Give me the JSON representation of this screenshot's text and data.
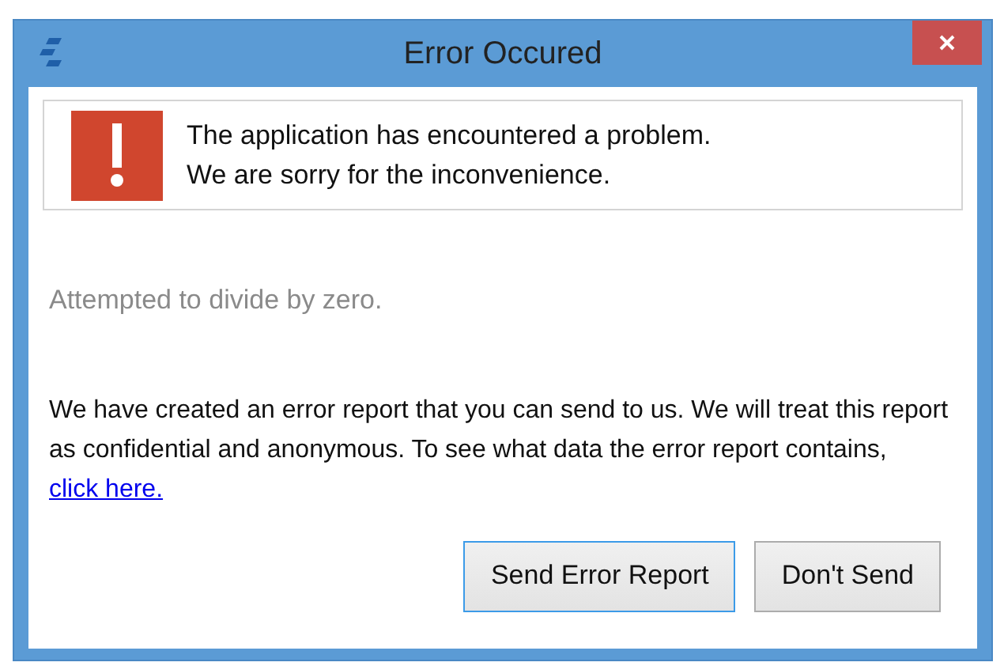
{
  "window": {
    "title": "Error Occured"
  },
  "banner": {
    "lines": [
      "The application has encountered a problem.",
      "We are sorry for the inconvenience."
    ]
  },
  "error_message": "Attempted to divide by zero.",
  "report_text": "We have created an error report that you can send to us.  We will treat this report as confidential and anonymous.  To see what data the error report contains,",
  "link": "click here.",
  "buttons": [
    {
      "label": "Send Error Report",
      "default": true
    },
    {
      "label": "Don't Send",
      "default": false
    }
  ]
}
